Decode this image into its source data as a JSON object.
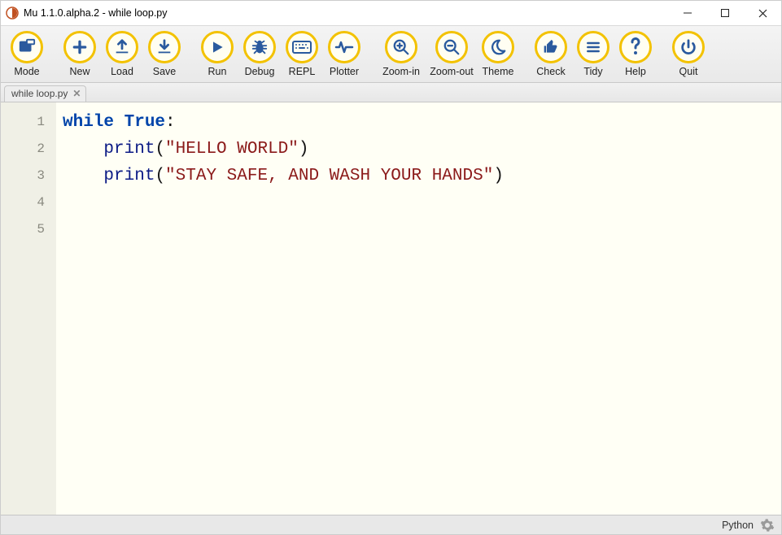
{
  "window": {
    "title": "Mu 1.1.0.alpha.2 - while loop.py"
  },
  "toolbar": {
    "groups": [
      [
        {
          "id": "mode",
          "label": "Mode",
          "icon": "mode"
        }
      ],
      [
        {
          "id": "new",
          "label": "New",
          "icon": "plus"
        },
        {
          "id": "load",
          "label": "Load",
          "icon": "load"
        },
        {
          "id": "save",
          "label": "Save",
          "icon": "save"
        }
      ],
      [
        {
          "id": "run",
          "label": "Run",
          "icon": "play"
        },
        {
          "id": "debug",
          "label": "Debug",
          "icon": "bug"
        },
        {
          "id": "repl",
          "label": "REPL",
          "icon": "keyboard"
        },
        {
          "id": "plotter",
          "label": "Plotter",
          "icon": "pulse"
        }
      ],
      [
        {
          "id": "zoomin",
          "label": "Zoom-in",
          "icon": "zoomin",
          "wide": true
        },
        {
          "id": "zoomout",
          "label": "Zoom-out",
          "icon": "zoomout",
          "wide": true
        },
        {
          "id": "theme",
          "label": "Theme",
          "icon": "moon"
        }
      ],
      [
        {
          "id": "check",
          "label": "Check",
          "icon": "thumb"
        },
        {
          "id": "tidy",
          "label": "Tidy",
          "icon": "lines"
        },
        {
          "id": "help",
          "label": "Help",
          "icon": "help"
        }
      ],
      [
        {
          "id": "quit",
          "label": "Quit",
          "icon": "power"
        }
      ]
    ]
  },
  "tabs": [
    {
      "name": "while loop.py"
    }
  ],
  "editor": {
    "lineNumbers": [
      "1",
      "2",
      "3",
      "4",
      "5"
    ],
    "code": [
      {
        "tokens": [
          {
            "t": "kw",
            "s": "while"
          },
          {
            "t": "txt",
            "s": " "
          },
          {
            "t": "kw",
            "s": "True"
          },
          {
            "t": "pun",
            "s": ":"
          }
        ]
      },
      {
        "indent": "    ",
        "tokens": [
          {
            "t": "fn",
            "s": "print"
          },
          {
            "t": "pun",
            "s": "("
          },
          {
            "t": "str",
            "s": "\"HELLO WORLD\""
          },
          {
            "t": "pun",
            "s": ")"
          }
        ]
      },
      {
        "indent": "    ",
        "tokens": [
          {
            "t": "fn",
            "s": "print"
          },
          {
            "t": "pun",
            "s": "("
          },
          {
            "t": "str",
            "s": "\"STAY SAFE, AND WASH YOUR HANDS\""
          },
          {
            "t": "pun",
            "s": ")"
          }
        ]
      },
      {
        "tokens": []
      },
      {
        "tokens": []
      }
    ]
  },
  "status": {
    "language": "Python"
  }
}
